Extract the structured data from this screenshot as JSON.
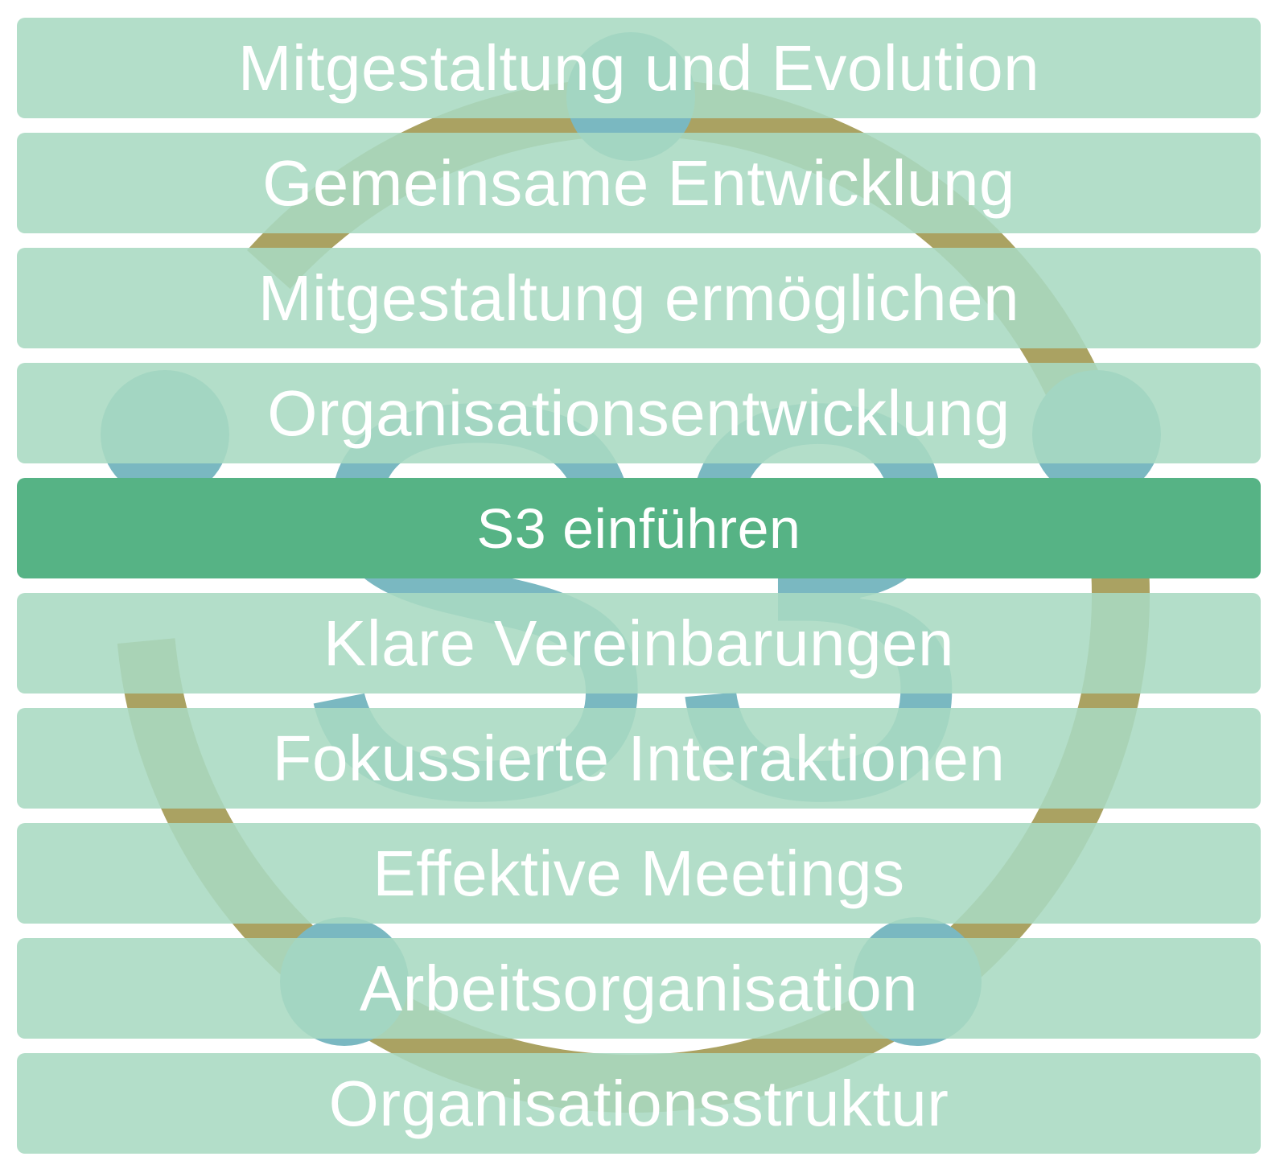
{
  "menu": {
    "items": [
      {
        "label": "Mitgestaltung und Evolution",
        "active": false
      },
      {
        "label": "Gemeinsame Entwicklung",
        "active": false
      },
      {
        "label": "Mitgestaltung ermöglichen",
        "active": false
      },
      {
        "label": "Organisationsentwicklung",
        "active": false
      },
      {
        "label": "S3 einführen",
        "active": true
      },
      {
        "label": "Klare Vereinbarungen",
        "active": false
      },
      {
        "label": "Fokussierte Interaktionen",
        "active": false
      },
      {
        "label": "Effektive Meetings",
        "active": false
      },
      {
        "label": "Arbeitsorganisation",
        "active": false
      },
      {
        "label": "Organisationsstruktur",
        "active": false
      }
    ]
  },
  "colors": {
    "item_background": "#a8dac2",
    "item_active_background": "#56b385",
    "item_text": "#ffffff",
    "logo_ring": "#aaa262",
    "logo_circles": "#7ab8c1"
  },
  "icons": {
    "background": "s3-logo-icon"
  }
}
